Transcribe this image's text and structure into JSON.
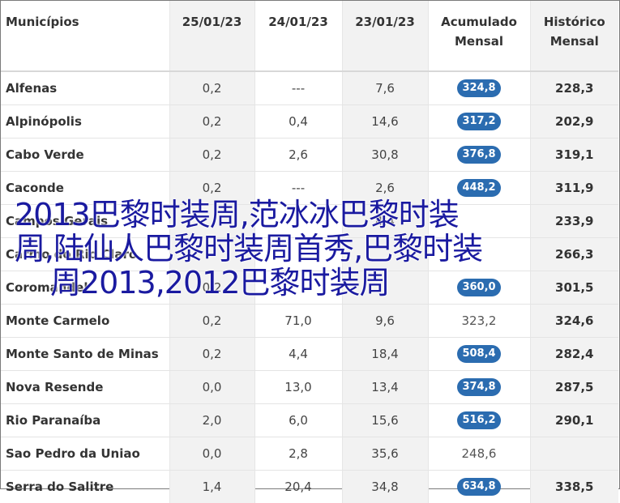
{
  "table": {
    "headers": {
      "municipio": "Municípios",
      "d1": "25/01/23",
      "d2": "24/01/23",
      "d3": "23/01/23",
      "acumulado_line1": "Acumulado",
      "acumulado_line2": "Mensal",
      "historico_line1": "Histórico",
      "historico_line2": "Mensal"
    },
    "rows": [
      {
        "name": "Alfenas",
        "d1": "0,2",
        "d2": "---",
        "d3": "7,6",
        "acc": "324,8",
        "acc_badge": true,
        "hist": "228,3"
      },
      {
        "name": "Alpinópolis",
        "d1": "0,2",
        "d2": "0,4",
        "d3": "14,6",
        "acc": "317,2",
        "acc_badge": true,
        "hist": "202,9"
      },
      {
        "name": "Cabo Verde",
        "d1": "0,2",
        "d2": "2,6",
        "d3": "30,8",
        "acc": "376,8",
        "acc_badge": true,
        "hist": "319,1"
      },
      {
        "name": "Caconde",
        "d1": "0,2",
        "d2": "---",
        "d3": "2,6",
        "acc": "448,2",
        "acc_badge": true,
        "hist": "311,9"
      },
      {
        "name": "Campos Gerais",
        "d1": "",
        "d2": "",
        "d3": "4,4",
        "acc": "",
        "acc_badge": false,
        "hist": "233,9"
      },
      {
        "name": "Carmo do Rio Claro",
        "d1": "",
        "d2": "",
        "d3": "",
        "acc": "",
        "acc_badge": false,
        "hist": "266,3"
      },
      {
        "name": "Coromandel",
        "d1": "0,2",
        "d2": "",
        "d3": "",
        "acc": "360,0",
        "acc_badge": true,
        "hist": "301,5"
      },
      {
        "name": "Monte Carmelo",
        "d1": "0,2",
        "d2": "71,0",
        "d3": "9,6",
        "acc": "323,2",
        "acc_badge": false,
        "hist": "324,6"
      },
      {
        "name": "Monte Santo de Minas",
        "d1": "0,2",
        "d2": "4,4",
        "d3": "18,4",
        "acc": "508,4",
        "acc_badge": true,
        "hist": "282,4"
      },
      {
        "name": "Nova Resende",
        "d1": "0,0",
        "d2": "13,0",
        "d3": "13,4",
        "acc": "374,8",
        "acc_badge": true,
        "hist": "287,5"
      },
      {
        "name": "Rio Paranaíba",
        "d1": "2,0",
        "d2": "6,0",
        "d3": "15,6",
        "acc": "516,2",
        "acc_badge": true,
        "hist": "290,1"
      },
      {
        "name": "Sao Pedro da Uniao",
        "d1": "0,0",
        "d2": "2,8",
        "d3": "35,6",
        "acc": "248,6",
        "acc_badge": false,
        "hist": ""
      },
      {
        "name": "Serra do Salitre",
        "d1": "1,4",
        "d2": "20,4",
        "d3": "34,8",
        "acc": "634,8",
        "acc_badge": true,
        "hist": "338,5"
      }
    ]
  },
  "overlay": {
    "line1": "2013巴黎时装周,范冰冰巴黎时装",
    "line2": "周,陆仙人巴黎时装周首秀,巴黎时装",
    "line3": "周2013,2012巴黎时装周"
  },
  "colors": {
    "badge": "#2b6cb0",
    "overlay_text": "#1a1aa0",
    "shaded_column": "#f2f2f2"
  }
}
